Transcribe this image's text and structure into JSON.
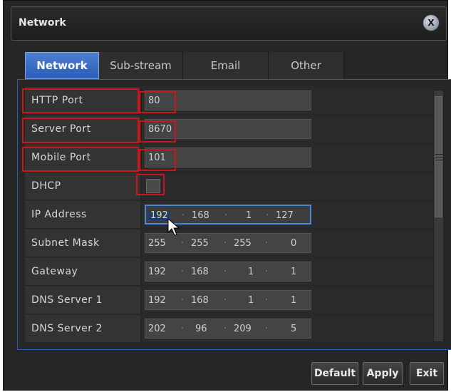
{
  "window": {
    "title": "Network",
    "close_label": "X"
  },
  "tabs": [
    {
      "label": "Network",
      "active": true
    },
    {
      "label": "Sub-stream",
      "active": false
    },
    {
      "label": "Email",
      "active": false
    },
    {
      "label": "Other",
      "active": false
    }
  ],
  "fields": {
    "http_port": {
      "label": "HTTP Port",
      "value": "80"
    },
    "server_port": {
      "label": "Server Port",
      "value": "8670"
    },
    "mobile_port": {
      "label": "Mobile Port",
      "value": "101"
    },
    "dhcp": {
      "label": "DHCP",
      "checked": false
    },
    "ip_address": {
      "label": "IP Address",
      "octets": [
        "192",
        "168",
        "1",
        "127"
      ]
    },
    "subnet_mask": {
      "label": "Subnet Mask",
      "octets": [
        "255",
        "255",
        "255",
        "0"
      ]
    },
    "gateway": {
      "label": "Gateway",
      "octets": [
        "192",
        "168",
        "1",
        "1"
      ]
    },
    "dns1": {
      "label": "DNS Server 1",
      "octets": [
        "192",
        "168",
        "1",
        "1"
      ]
    },
    "dns2": {
      "label": "DNS Server 2",
      "octets": [
        "202",
        "96",
        "209",
        "5"
      ]
    }
  },
  "buttons": {
    "default": "Default",
    "apply": "Apply",
    "exit": "Exit"
  },
  "colors": {
    "accent": "#2b5cb8",
    "highlight": "#c8161d",
    "focus_text": "#ffe14a"
  }
}
